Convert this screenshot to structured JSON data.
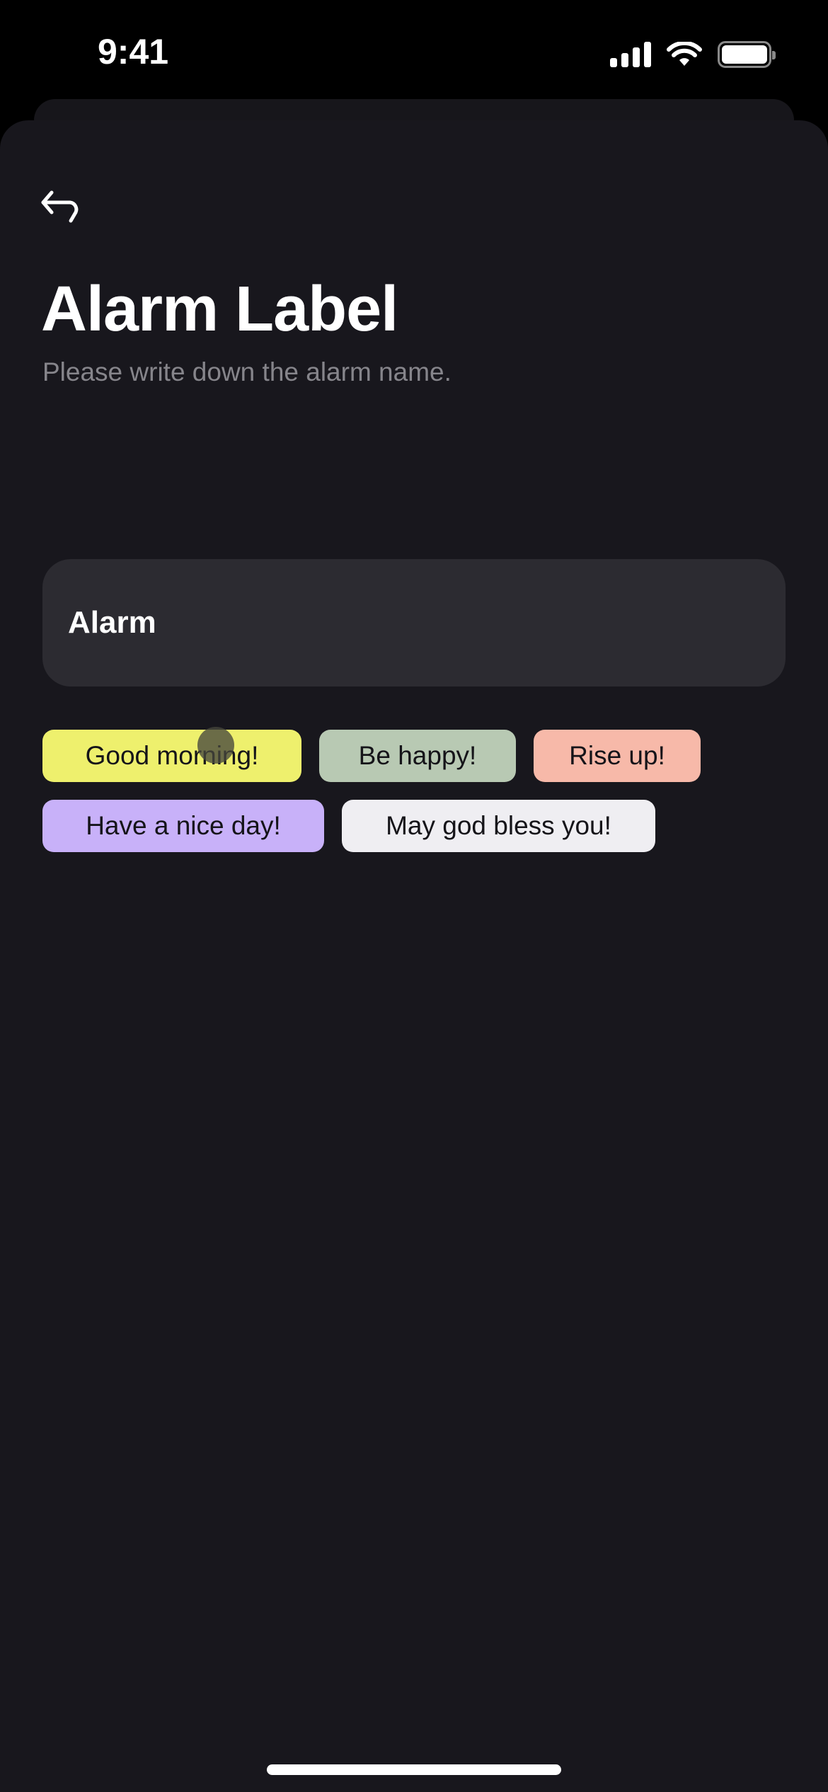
{
  "status_bar": {
    "time": "9:41",
    "icons": [
      "cellular-signal-icon",
      "wifi-icon",
      "battery-icon"
    ]
  },
  "header": {
    "back_icon": "back-arrow-icon",
    "title": "Alarm Label",
    "subtitle": "Please write down the alarm name."
  },
  "label_input": {
    "value": "Alarm",
    "background": "#2c2b31"
  },
  "suggestions": [
    {
      "label": "Good morning!",
      "color": "#eef06d"
    },
    {
      "label": "Be happy!",
      "color": "#b8c9b3"
    },
    {
      "label": "Rise up!",
      "color": "#f7b9a9"
    },
    {
      "label": "Have a nice day!",
      "color": "#c8b1f9"
    },
    {
      "label": "May god bless you!",
      "color": "#efeef2"
    }
  ],
  "theme": {
    "background": "#18171d",
    "text_primary": "#ffffff",
    "text_secondary": "#86858b"
  }
}
